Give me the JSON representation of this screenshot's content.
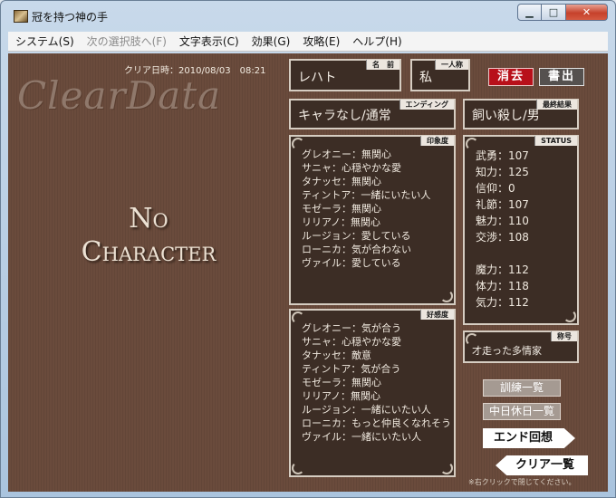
{
  "window": {
    "title": "冠を持つ神の手"
  },
  "menu": [
    {
      "label": "システム(S)",
      "enabled": true
    },
    {
      "label": "次の選択肢へ(F)",
      "enabled": false
    },
    {
      "label": "文字表示(C)",
      "enabled": true
    },
    {
      "label": "効果(G)",
      "enabled": true
    },
    {
      "label": "攻略(E)",
      "enabled": true
    },
    {
      "label": "ヘルプ(H)",
      "enabled": true
    }
  ],
  "clear": {
    "date_text": "クリア日時：2010/08/03　08:21",
    "logo": "ClearData",
    "no_char_line1": "No",
    "no_char_line2": "Character"
  },
  "name": {
    "title": "名　前",
    "value": "レハト"
  },
  "pronoun": {
    "title": "一人称",
    "value": "私"
  },
  "buttons": {
    "erase": "消去",
    "write": "書出",
    "training": "訓練一覧",
    "holiday": "中日休日一覧",
    "end_recall": "エンド回想",
    "clear_list": "クリア一覧"
  },
  "ending": {
    "title": "エンディング",
    "value": "キャラなし/通常"
  },
  "final": {
    "title": "最終結果",
    "value": "飼い殺し/男"
  },
  "impression": {
    "title": "印象度",
    "rows": [
      "グレオニー：無関心",
      "サニャ：心穏やかな愛",
      "タナッセ：無関心",
      "ティントア：一緒にいたい人",
      "モゼーラ：無関心",
      "リリアノ：無関心",
      "ルージョン：愛している",
      "ローニカ：気が合わない",
      "ヴァイル：愛している"
    ]
  },
  "favor": {
    "title": "好感度",
    "rows": [
      "グレオニー：気が合う",
      "サニャ：心穏やかな愛",
      "タナッセ：敵意",
      "ティントア：気が合う",
      "モゼーラ：無関心",
      "リリアノ：無関心",
      "ルージョン：一緒にいたい人",
      "ローニカ：もっと仲良くなれそう",
      "ヴァイル：一緒にいたい人"
    ]
  },
  "status": {
    "title": "STATUS",
    "rows": [
      "武勇：107",
      "知力：125",
      "信仰：0",
      "礼節：107",
      "魅力：110",
      "交渉：108",
      "",
      "魔力：112",
      "体力：118",
      "気力：112"
    ]
  },
  "title_badge": {
    "title": "称号",
    "value": "才走った多情家"
  },
  "hint": "※右クリックで閉じてください。"
}
